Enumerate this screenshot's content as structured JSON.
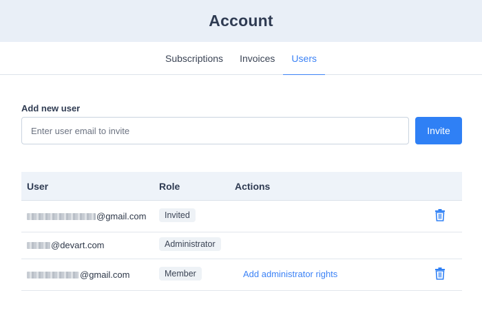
{
  "header": {
    "title": "Account"
  },
  "tabs": [
    {
      "label": "Subscriptions",
      "active": false
    },
    {
      "label": "Invoices",
      "active": false
    },
    {
      "label": "Users",
      "active": true
    }
  ],
  "add_user": {
    "label": "Add new user",
    "placeholder": "Enter user email to invite",
    "value": "",
    "button_label": "Invite"
  },
  "table": {
    "headers": {
      "user": "User",
      "role": "Role",
      "actions": "Actions"
    },
    "rows": [
      {
        "email_suffix": "@gmail.com",
        "role": "Invited",
        "action": "",
        "delete_icon": "trash-icon"
      },
      {
        "email_suffix": "@devart.com",
        "role": "Administrator",
        "action": "",
        "delete_icon": ""
      },
      {
        "email_suffix": "@gmail.com",
        "role": "Member",
        "action": "Add administrator rights",
        "delete_icon": "trash-icon"
      }
    ]
  },
  "colors": {
    "accent": "#2f80f5",
    "header_bg": "#e9eff7",
    "table_header_bg": "#eef3f9",
    "link": "#3b82f6"
  }
}
